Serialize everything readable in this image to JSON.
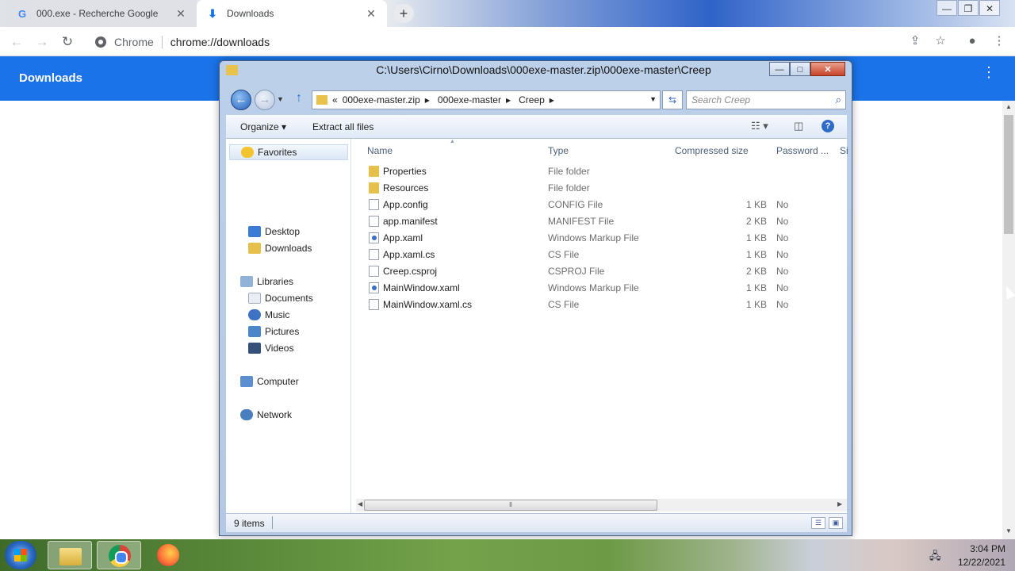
{
  "browser": {
    "tabs": [
      {
        "title": "000.exe - Recherche Google",
        "icon": "google-g-icon"
      },
      {
        "title": "Downloads",
        "icon": "download-icon"
      }
    ],
    "omnibox": {
      "chip": "Chrome",
      "url": "chrome://downloads"
    }
  },
  "downloads_page": {
    "title": "Downloads"
  },
  "explorer": {
    "title": "C:\\Users\\Cirno\\Downloads\\000exe-master.zip\\000exe-master\\Creep",
    "breadcrumb": [
      "000exe-master.zip",
      "000exe-master",
      "Creep"
    ],
    "breadcrumb_prefix": "«",
    "search_placeholder": "Search Creep",
    "commands": {
      "organize": "Organize",
      "extract": "Extract all files"
    },
    "nav": {
      "favorites": "Favorites",
      "desktop": "Desktop",
      "downloads": "Downloads",
      "libraries": "Libraries",
      "documents": "Documents",
      "music": "Music",
      "pictures": "Pictures",
      "videos": "Videos",
      "computer": "Computer",
      "network": "Network"
    },
    "columns": {
      "name": "Name",
      "type": "Type",
      "size": "Compressed size",
      "password": "Password ...",
      "more": "Si"
    },
    "files": [
      {
        "name": "Properties",
        "type": "File folder",
        "size": "",
        "password": "",
        "icon": "folder"
      },
      {
        "name": "Resources",
        "type": "File folder",
        "size": "",
        "password": "",
        "icon": "folder"
      },
      {
        "name": "App.config",
        "type": "CONFIG File",
        "size": "1 KB",
        "password": "No",
        "icon": "doc"
      },
      {
        "name": "app.manifest",
        "type": "MANIFEST File",
        "size": "2 KB",
        "password": "No",
        "icon": "doc"
      },
      {
        "name": "App.xaml",
        "type": "Windows Markup File",
        "size": "1 KB",
        "password": "No",
        "icon": "xaml"
      },
      {
        "name": "App.xaml.cs",
        "type": "CS File",
        "size": "1 KB",
        "password": "No",
        "icon": "doc"
      },
      {
        "name": "Creep.csproj",
        "type": "CSPROJ File",
        "size": "2 KB",
        "password": "No",
        "icon": "doc"
      },
      {
        "name": "MainWindow.xaml",
        "type": "Windows Markup File",
        "size": "1 KB",
        "password": "No",
        "icon": "xaml"
      },
      {
        "name": "MainWindow.xaml.cs",
        "type": "CS File",
        "size": "1 KB",
        "password": "No",
        "icon": "doc"
      }
    ],
    "status": {
      "count": "9 items"
    }
  },
  "taskbar": {
    "time": "3:04 PM",
    "date": "12/22/2021"
  },
  "colors": {
    "accent": "#1a73e8",
    "folder": "#e6c04b"
  }
}
